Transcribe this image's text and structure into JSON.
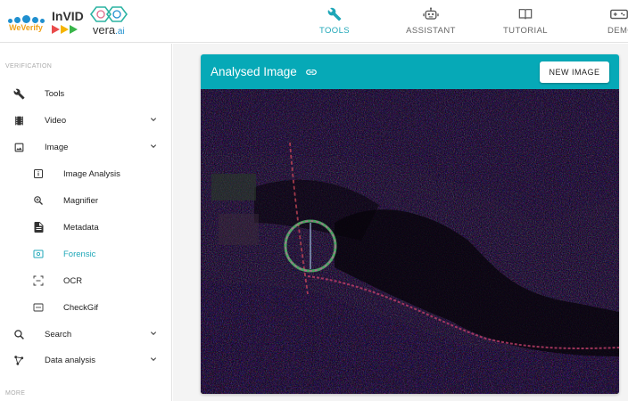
{
  "header": {
    "logos": {
      "weverify": "WeVerify",
      "invid": "InVID",
      "vera": "vera",
      "vera_suffix": ".ai"
    },
    "nav": [
      {
        "label": "TOOLS",
        "icon": "wrench-icon",
        "active": true
      },
      {
        "label": "ASSISTANT",
        "icon": "robot-icon",
        "active": false
      },
      {
        "label": "TUTORIAL",
        "icon": "book-icon",
        "active": false
      },
      {
        "label": "DEMO",
        "icon": "gamepad-icon",
        "active": false
      }
    ],
    "accent_color": "#1fa7b8"
  },
  "sidebar": {
    "section_verification": "VERIFICATION",
    "section_more": "MORE",
    "items": [
      {
        "label": "Tools",
        "icon": "wrench-icon"
      },
      {
        "label": "Video",
        "icon": "film-icon",
        "expandable": true
      },
      {
        "label": "Image",
        "icon": "image-icon",
        "expandable": true
      },
      {
        "label": "Image Analysis",
        "icon": "info-box-icon",
        "sub": true
      },
      {
        "label": "Magnifier",
        "icon": "magnifier-icon",
        "sub": true
      },
      {
        "label": "Metadata",
        "icon": "document-icon",
        "sub": true
      },
      {
        "label": "Forensic",
        "icon": "forensic-icon",
        "sub": true,
        "active": true
      },
      {
        "label": "OCR",
        "icon": "ocr-icon",
        "sub": true
      },
      {
        "label": "CheckGif",
        "icon": "gif-icon",
        "sub": true
      },
      {
        "label": "Search",
        "icon": "search-icon",
        "expandable": true
      },
      {
        "label": "Data analysis",
        "icon": "graph-icon",
        "expandable": true
      }
    ]
  },
  "main": {
    "card_title": "Analysed Image",
    "new_image_label": "NEW IMAGE",
    "card_color": "#06a9b7",
    "image_description_icon": "forensic-noise-map-image"
  }
}
